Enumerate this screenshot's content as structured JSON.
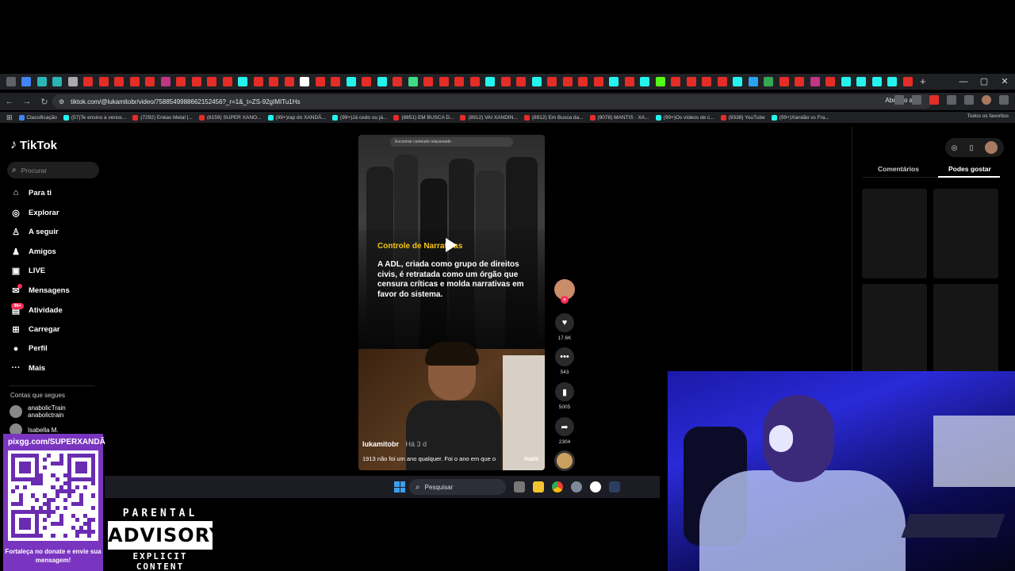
{
  "browser": {
    "url": "tiktok.com/@lukamitobr/video/7588549988662152456?_r=1&_t=ZS-92gIMITu1Hs",
    "open_app_label": "Abrir no app",
    "all_favorites_label": "Todos os favoritos",
    "tab_colors": [
      "#5f6368",
      "#4285f4",
      "#2bb5b5",
      "#2bb5b5",
      "#aaaaaa",
      "#e52d27",
      "#e52d27",
      "#e52d27",
      "#e52d27",
      "#e52d27",
      "#c13584",
      "#e52d27",
      "#e52d27",
      "#e52d27",
      "#e52d27",
      "#25f4ee",
      "#e52d27",
      "#e52d27",
      "#e52d27",
      "#ffffff",
      "#e52d27",
      "#e52d27",
      "#25f4ee",
      "#e52d27",
      "#25f4ee",
      "#e52d27",
      "#3ddc84",
      "#e52d27",
      "#e52d27",
      "#e52d27",
      "#e52d27",
      "#25f4ee",
      "#e52d27",
      "#e52d27",
      "#25f4ee",
      "#e52d27",
      "#e52d27",
      "#e52d27",
      "#e52d27",
      "#25f4ee",
      "#e52d27",
      "#25f4ee",
      "#53fc18",
      "#e52d27",
      "#e52d27",
      "#e52d27",
      "#e52d27",
      "#25f4ee",
      "#2aa3f0",
      "#34a853",
      "#e52d27",
      "#e52d27",
      "#c13584",
      "#e52d27",
      "#25f4ee",
      "#25f4ee",
      "#25f4ee",
      "#25f4ee",
      "#e52d27"
    ],
    "bookmarks": [
      {
        "label": "Classificação",
        "color": "#4285f4"
      },
      {
        "label": "(57)Te ensino a vence...",
        "color": "#25f4ee"
      },
      {
        "label": "(7292) Enéas Metal |...",
        "color": "#e52d27"
      },
      {
        "label": "(8159) SUPER XANO...",
        "color": "#e52d27"
      },
      {
        "label": "(99+)rap do XANDÃ...",
        "color": "#25f4ee"
      },
      {
        "label": "(99+)Já cedo ou já...",
        "color": "#25f4ee"
      },
      {
        "label": "(8851) EM BUSCA D...",
        "color": "#e52d27"
      },
      {
        "label": "(8912) VAI XANDIN...",
        "color": "#e52d27"
      },
      {
        "label": "(8912) Em Busca da...",
        "color": "#e52d27"
      },
      {
        "label": "(9078) MANTIS · XA...",
        "color": "#e52d27"
      },
      {
        "label": "(99+)Os vídeos de c...",
        "color": "#25f4ee"
      },
      {
        "label": "(9338) YouTube",
        "color": "#e52d27"
      },
      {
        "label": "(99+)Xandão vs Fra...",
        "color": "#25f4ee"
      }
    ]
  },
  "tiktok": {
    "logo": "TikTok",
    "search_placeholder": "Procurar",
    "nav": [
      {
        "label": "Para ti",
        "icon": "home-icon",
        "glyph": "⌂"
      },
      {
        "label": "Explorar",
        "icon": "compass-icon",
        "glyph": "◎"
      },
      {
        "label": "A seguir",
        "icon": "following-icon",
        "glyph": "♙"
      },
      {
        "label": "Amigos",
        "icon": "friends-icon",
        "glyph": "♟"
      },
      {
        "label": "LIVE",
        "icon": "live-icon",
        "glyph": "▣"
      },
      {
        "label": "Mensagens",
        "icon": "messages-icon",
        "glyph": "✉"
      },
      {
        "label": "Atividade",
        "icon": "activity-icon",
        "glyph": "▤"
      },
      {
        "label": "Carregar",
        "icon": "upload-icon",
        "glyph": "⊞"
      },
      {
        "label": "Perfil",
        "icon": "profile-icon",
        "glyph": "●"
      },
      {
        "label": "Mais",
        "icon": "more-icon",
        "glyph": "···"
      }
    ],
    "activity_badge": "99+",
    "following_title": "Contas que segues",
    "following": [
      {
        "name": "anabolicTrain",
        "handle": "anabolictrain"
      },
      {
        "name": "Isabella M.",
        "handle": ""
      }
    ],
    "video": {
      "search_placeholder": "Encontrar conteúdo relacionado",
      "title": "Controle de Narrativas",
      "body": "A ADL, criada como grupo de direitos civis, é retratada como um órgão que censura críticas e molda narrativas em favor do sistema.",
      "author": "lukamitobr",
      "posted": "Há 3 d",
      "caption": "1913 não foi um ano qualquer. Foi o ano em que o",
      "more": "mais"
    },
    "actions": {
      "likes": "17.6K",
      "comments": "543",
      "saves": "5005",
      "shares": "2304"
    },
    "right_tabs": [
      "Comentários",
      "Podes gostar"
    ]
  },
  "taskbar": {
    "search_placeholder": "Pesquisar"
  },
  "overlays": {
    "pix_url": "pixgg.com/SUPERXANDÃ",
    "pix_message": "Fortaleça no donate e envie sua mensagem!",
    "advisory_top": "PARENTAL",
    "advisory_mid": "ADVISORY",
    "advisory_bottom": "EXPLICIT CONTENT"
  },
  "colors": {
    "tiktok_red": "#fe2c55",
    "highlight_yellow": "#f5c518",
    "pix_purple": "#7a35c0"
  }
}
